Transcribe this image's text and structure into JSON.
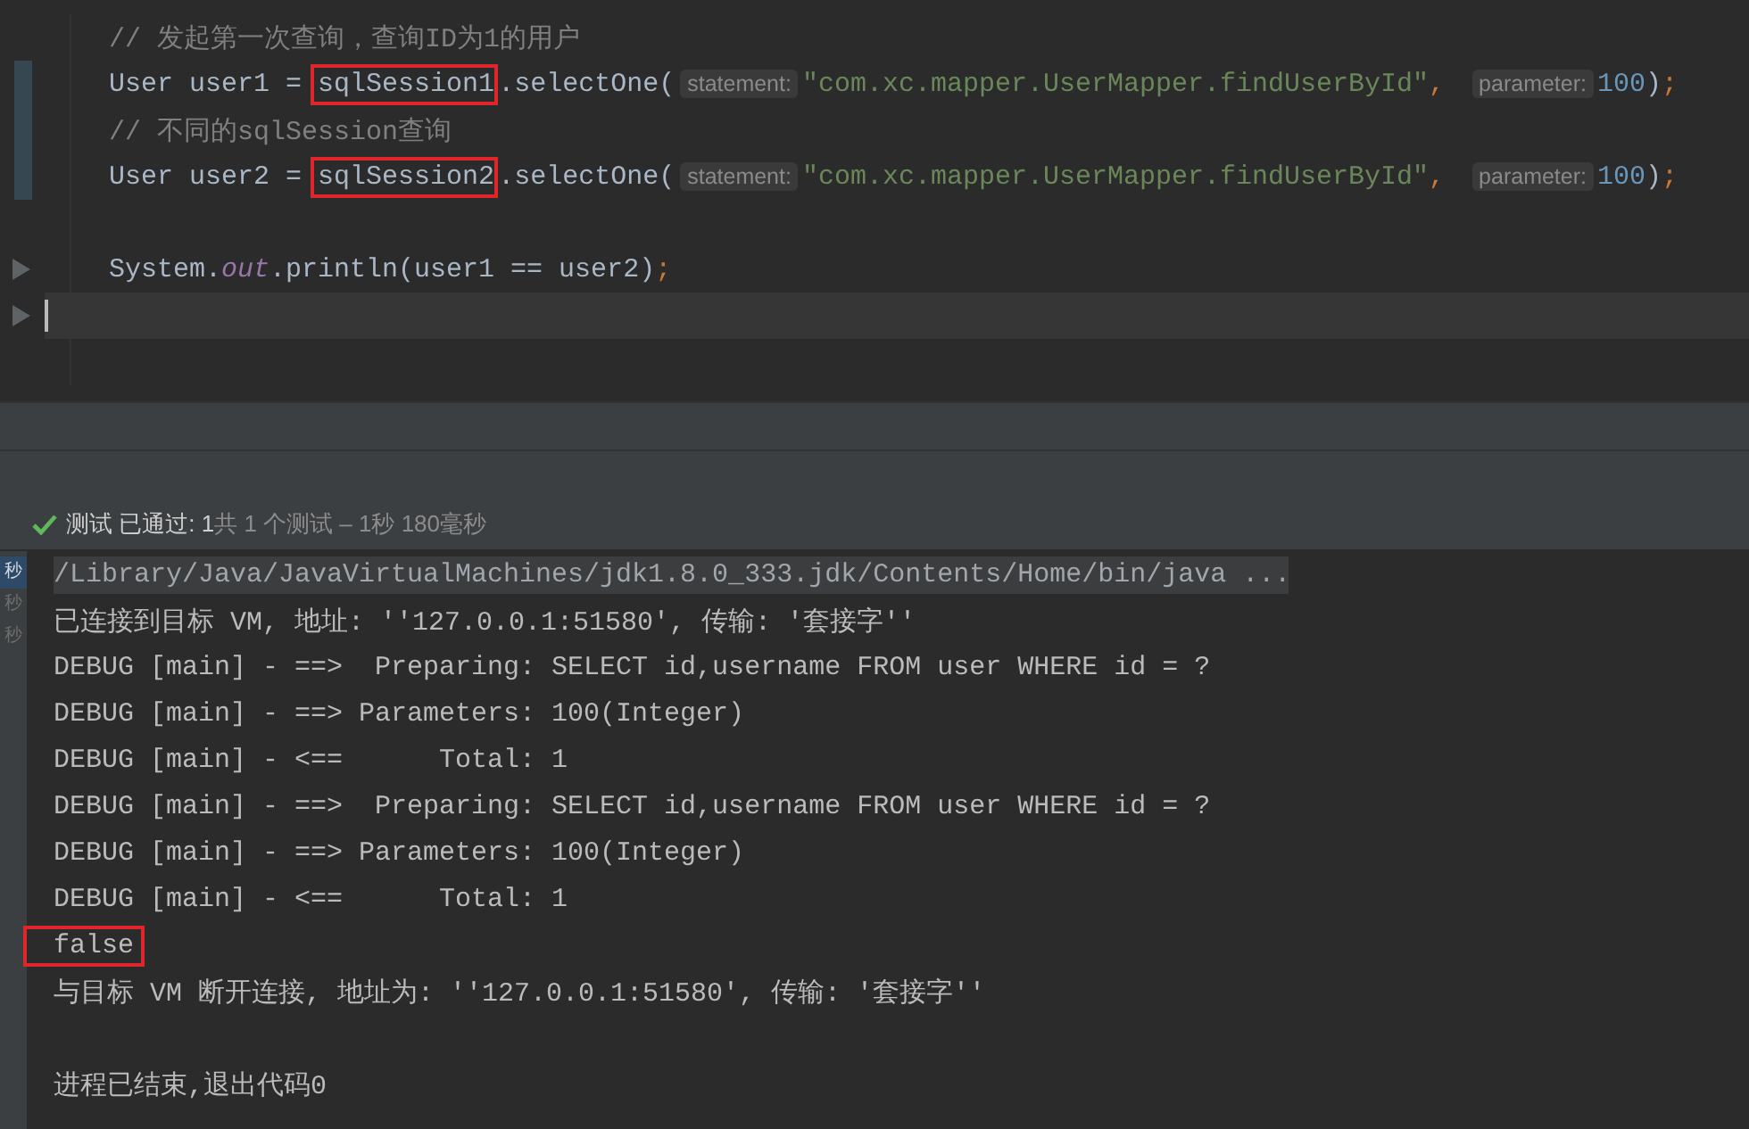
{
  "editor": {
    "lines": [
      {
        "kind": "code",
        "segments": [
          {
            "kind": "comment",
            "text": "// 发起第一次查询，查询ID为1的用户"
          }
        ]
      },
      {
        "kind": "code",
        "changed": true,
        "segments": [
          {
            "kind": "plain",
            "text": "User user1 = "
          },
          {
            "kind": "boxed",
            "text": "sqlSession1"
          },
          {
            "kind": "plain",
            "text": ".selectOne("
          },
          {
            "kind": "hint",
            "text": "statement:"
          },
          {
            "kind": "string",
            "text": "\"com.xc.mapper.UserMapper.findUserById\""
          },
          {
            "kind": "punct",
            "text": ","
          },
          {
            "kind": "hint",
            "text": "parameter:"
          },
          {
            "kind": "number",
            "text": "100"
          },
          {
            "kind": "plain",
            "text": ")"
          },
          {
            "kind": "punct",
            "text": ";"
          }
        ]
      },
      {
        "kind": "code",
        "changed": true,
        "segments": [
          {
            "kind": "comment",
            "text": "// 不同的sqlSession查询"
          }
        ]
      },
      {
        "kind": "code",
        "changed": true,
        "segments": [
          {
            "kind": "plain",
            "text": "User user2 = "
          },
          {
            "kind": "boxed",
            "text": "sqlSession2"
          },
          {
            "kind": "plain",
            "text": ".selectOne("
          },
          {
            "kind": "hint",
            "text": "statement:"
          },
          {
            "kind": "string",
            "text": "\"com.xc.mapper.UserMapper.findUserById\""
          },
          {
            "kind": "punct",
            "text": ","
          },
          {
            "kind": "hint",
            "text": "parameter:"
          },
          {
            "kind": "number",
            "text": "100"
          },
          {
            "kind": "plain",
            "text": ")"
          },
          {
            "kind": "punct",
            "text": ";"
          }
        ]
      },
      {
        "kind": "blank"
      },
      {
        "kind": "code",
        "marker": true,
        "segments": [
          {
            "kind": "plain",
            "text": "System."
          },
          {
            "kind": "field",
            "text": "out"
          },
          {
            "kind": "plain",
            "text": ".println(user1 == user2)"
          },
          {
            "kind": "punct",
            "text": ";"
          }
        ]
      },
      {
        "kind": "blank",
        "current": true,
        "marker": true
      },
      {
        "kind": "blank"
      }
    ]
  },
  "test_status": {
    "passed": true,
    "label": "测试 已通过: 1",
    "detail": "共 1 个测试 – 1秒 180毫秒"
  },
  "console": {
    "timings": [
      {
        "text": "秒",
        "selected": true
      },
      {
        "text": "秒",
        "selected": false
      },
      {
        "text": "秒",
        "selected": false
      }
    ],
    "lines": [
      {
        "kind": "path",
        "text": "/Library/Java/JavaVirtualMachines/jdk1.8.0_333.jdk/Contents/Home/bin/java ..."
      },
      {
        "kind": "plain",
        "text": "已连接到目标 VM, 地址: ''127.0.0.1:51580', 传输: '套接字''"
      },
      {
        "kind": "plain",
        "text": "DEBUG [main] - ==>  Preparing: SELECT id,username FROM user WHERE id = ?"
      },
      {
        "kind": "plain",
        "text": "DEBUG [main] - ==> Parameters: 100(Integer)"
      },
      {
        "kind": "plain",
        "text": "DEBUG [main] - <==      Total: 1"
      },
      {
        "kind": "plain",
        "text": "DEBUG [main] - ==>  Preparing: SELECT id,username FROM user WHERE id = ?"
      },
      {
        "kind": "plain",
        "text": "DEBUG [main] - ==> Parameters: 100(Integer)"
      },
      {
        "kind": "plain",
        "text": "DEBUG [main] - <==      Total: 1"
      },
      {
        "kind": "plain",
        "boxed": true,
        "text": "false"
      },
      {
        "kind": "plain",
        "text": "与目标 VM 断开连接, 地址为: ''127.0.0.1:51580', 传输: '套接字''"
      },
      {
        "kind": "blank"
      },
      {
        "kind": "plain",
        "text": "进程已结束,退出代码0"
      }
    ]
  }
}
